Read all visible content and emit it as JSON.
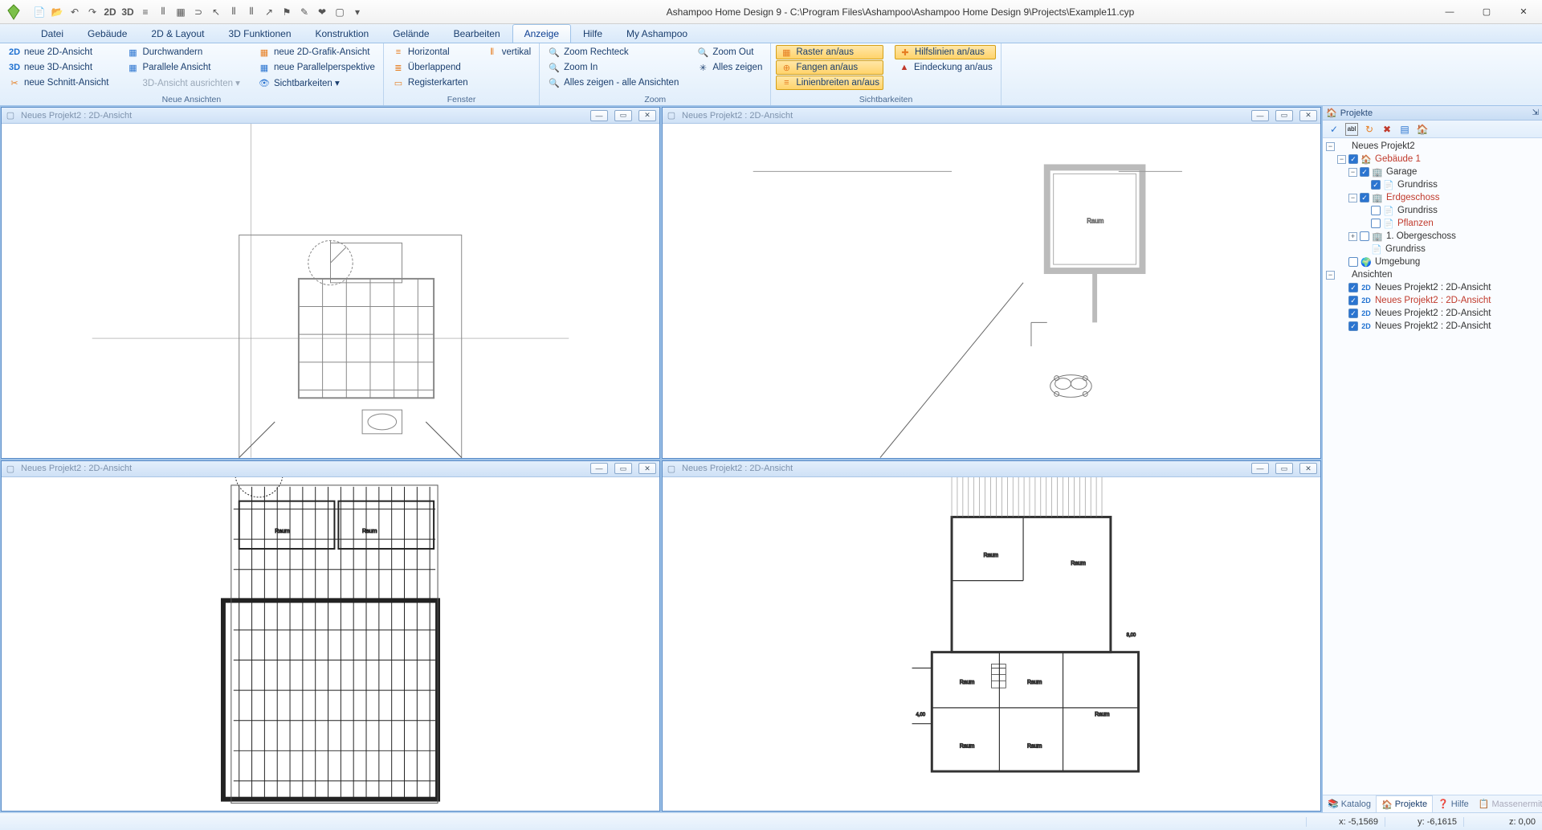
{
  "app": {
    "title": "Ashampoo Home Design 9 - C:\\Program Files\\Ashampoo\\Ashampoo Home Design 9\\Projects\\Example11.cyp"
  },
  "menu": {
    "tabs": [
      "Datei",
      "Gebäude",
      "2D & Layout",
      "3D Funktionen",
      "Konstruktion",
      "Gelände",
      "Bearbeiten",
      "Anzeige",
      "Hilfe",
      "My Ashampoo"
    ],
    "active": "Anzeige"
  },
  "ribbon": {
    "groups": [
      {
        "label": "Neue Ansichten",
        "cols": [
          [
            {
              "icon": "2D",
              "text": "neue 2D-Ansicht"
            },
            {
              "icon": "3D",
              "text": "neue 3D-Ansicht"
            },
            {
              "icon": "✂",
              "text": "neue Schnitt-Ansicht",
              "iconClass": "ic-orange"
            }
          ],
          [
            {
              "icon": "▦",
              "text": "Durchwandern",
              "iconClass": "ic-blue"
            },
            {
              "icon": "▦",
              "text": "Parallele Ansicht",
              "iconClass": "ic-blue"
            },
            {
              "icon": "",
              "text": "3D-Ansicht ausrichten ▾",
              "disabled": true
            }
          ],
          [
            {
              "icon": "▦",
              "text": "neue 2D-Grafik-Ansicht",
              "iconClass": "ic-orange"
            },
            {
              "icon": "▦",
              "text": "neue Parallelperspektive",
              "iconClass": "ic-blue"
            },
            {
              "icon": "👁",
              "text": "Sichtbarkeiten ▾",
              "iconClass": "ic-blue"
            }
          ]
        ]
      },
      {
        "label": "Fenster",
        "cols": [
          [
            {
              "icon": "≡",
              "text": "Horizontal",
              "iconClass": "ic-orange"
            },
            {
              "icon": "≣",
              "text": "Überlappend",
              "iconClass": "ic-orange"
            },
            {
              "icon": "▭",
              "text": "Registerkarten",
              "iconClass": "ic-orange"
            }
          ],
          [
            {
              "icon": "⦀",
              "text": "vertikal",
              "iconClass": "ic-orange"
            }
          ]
        ]
      },
      {
        "label": "Zoom",
        "cols": [
          [
            {
              "icon": "🔍",
              "text": "Zoom Rechteck"
            },
            {
              "icon": "🔍",
              "text": "Zoom In"
            },
            {
              "icon": "🔍",
              "text": "Alles zeigen - alle Ansichten"
            }
          ],
          [
            {
              "icon": "🔍",
              "text": "Zoom Out"
            },
            {
              "icon": "✳",
              "text": "Alles zeigen"
            }
          ]
        ]
      },
      {
        "label": "Sichtbarkeiten",
        "cols": [
          [
            {
              "icon": "▦",
              "text": "Raster an/aus",
              "toggled": true,
              "iconClass": "ic-orange"
            },
            {
              "icon": "⊕",
              "text": "Fangen an/aus",
              "toggled": true,
              "iconClass": "ic-orange"
            },
            {
              "icon": "≡",
              "text": "Linienbreiten an/aus",
              "toggled": true,
              "iconClass": "ic-orange"
            }
          ],
          [
            {
              "icon": "✚",
              "text": "Hilfslinien an/aus",
              "toggled": true,
              "iconClass": "ic-orange"
            },
            {
              "icon": "▲",
              "text": "Eindeckung an/aus",
              "iconClass": "ic-red"
            }
          ]
        ]
      }
    ]
  },
  "views": [
    {
      "title": "Neues Projekt2 : 2D-Ansicht"
    },
    {
      "title": "Neues Projekt2 : 2D-Ansicht"
    },
    {
      "title": "Neues Projekt2 : 2D-Ansicht"
    },
    {
      "title": "Neues Projekt2 : 2D-Ansicht"
    }
  ],
  "sidebar": {
    "title": "Projekte",
    "tree": [
      {
        "d": 0,
        "exp": "−",
        "chk": null,
        "ico": "",
        "lbl": "Neues Projekt2"
      },
      {
        "d": 1,
        "exp": "−",
        "chk": "on",
        "ico": "🏠",
        "lbl": "Gebäude 1",
        "hl": true
      },
      {
        "d": 2,
        "exp": "−",
        "chk": "on",
        "ico": "🏢",
        "lbl": "Garage"
      },
      {
        "d": 3,
        "exp": "",
        "chk": "on",
        "ico": "📄",
        "lbl": "Grundriss"
      },
      {
        "d": 2,
        "exp": "−",
        "chk": "on",
        "ico": "🏢",
        "lbl": "Erdgeschoss",
        "hl": true
      },
      {
        "d": 3,
        "exp": "",
        "chk": "off",
        "ico": "📄",
        "lbl": "Grundriss"
      },
      {
        "d": 3,
        "exp": "",
        "chk": "off",
        "ico": "📄",
        "lbl": "Pflanzen",
        "hl": true
      },
      {
        "d": 2,
        "exp": "+",
        "chk": "off",
        "ico": "🏢",
        "lbl": "1. Obergeschoss"
      },
      {
        "d": 3,
        "exp": "",
        "chk": null,
        "ico": "📄",
        "lbl": "Grundriss"
      },
      {
        "d": 1,
        "exp": "",
        "chk": "off",
        "ico": "🌍",
        "lbl": "Umgebung"
      },
      {
        "d": 0,
        "exp": "−",
        "chk": null,
        "ico": "",
        "lbl": "Ansichten"
      },
      {
        "d": 1,
        "exp": "",
        "chk": "on",
        "ico": "2D",
        "lbl": "Neues Projekt2 : 2D-Ansicht"
      },
      {
        "d": 1,
        "exp": "",
        "chk": "on",
        "ico": "2D",
        "lbl": "Neues Projekt2 : 2D-Ansicht",
        "hl": true
      },
      {
        "d": 1,
        "exp": "",
        "chk": "on",
        "ico": "2D",
        "lbl": "Neues Projekt2 : 2D-Ansicht"
      },
      {
        "d": 1,
        "exp": "",
        "chk": "on",
        "ico": "2D",
        "lbl": "Neues Projekt2 : 2D-Ansicht"
      }
    ],
    "tabs": [
      {
        "ico": "📚",
        "lbl": "Katalog"
      },
      {
        "ico": "🏠",
        "lbl": "Projekte",
        "active": true
      },
      {
        "ico": "❓",
        "lbl": "Hilfe"
      },
      {
        "ico": "📋",
        "lbl": "Massenermittlung",
        "disabled": true
      }
    ]
  },
  "status": {
    "x": "x: -5,1569",
    "y": "y: -6,1615",
    "z": "z: 0,00"
  }
}
